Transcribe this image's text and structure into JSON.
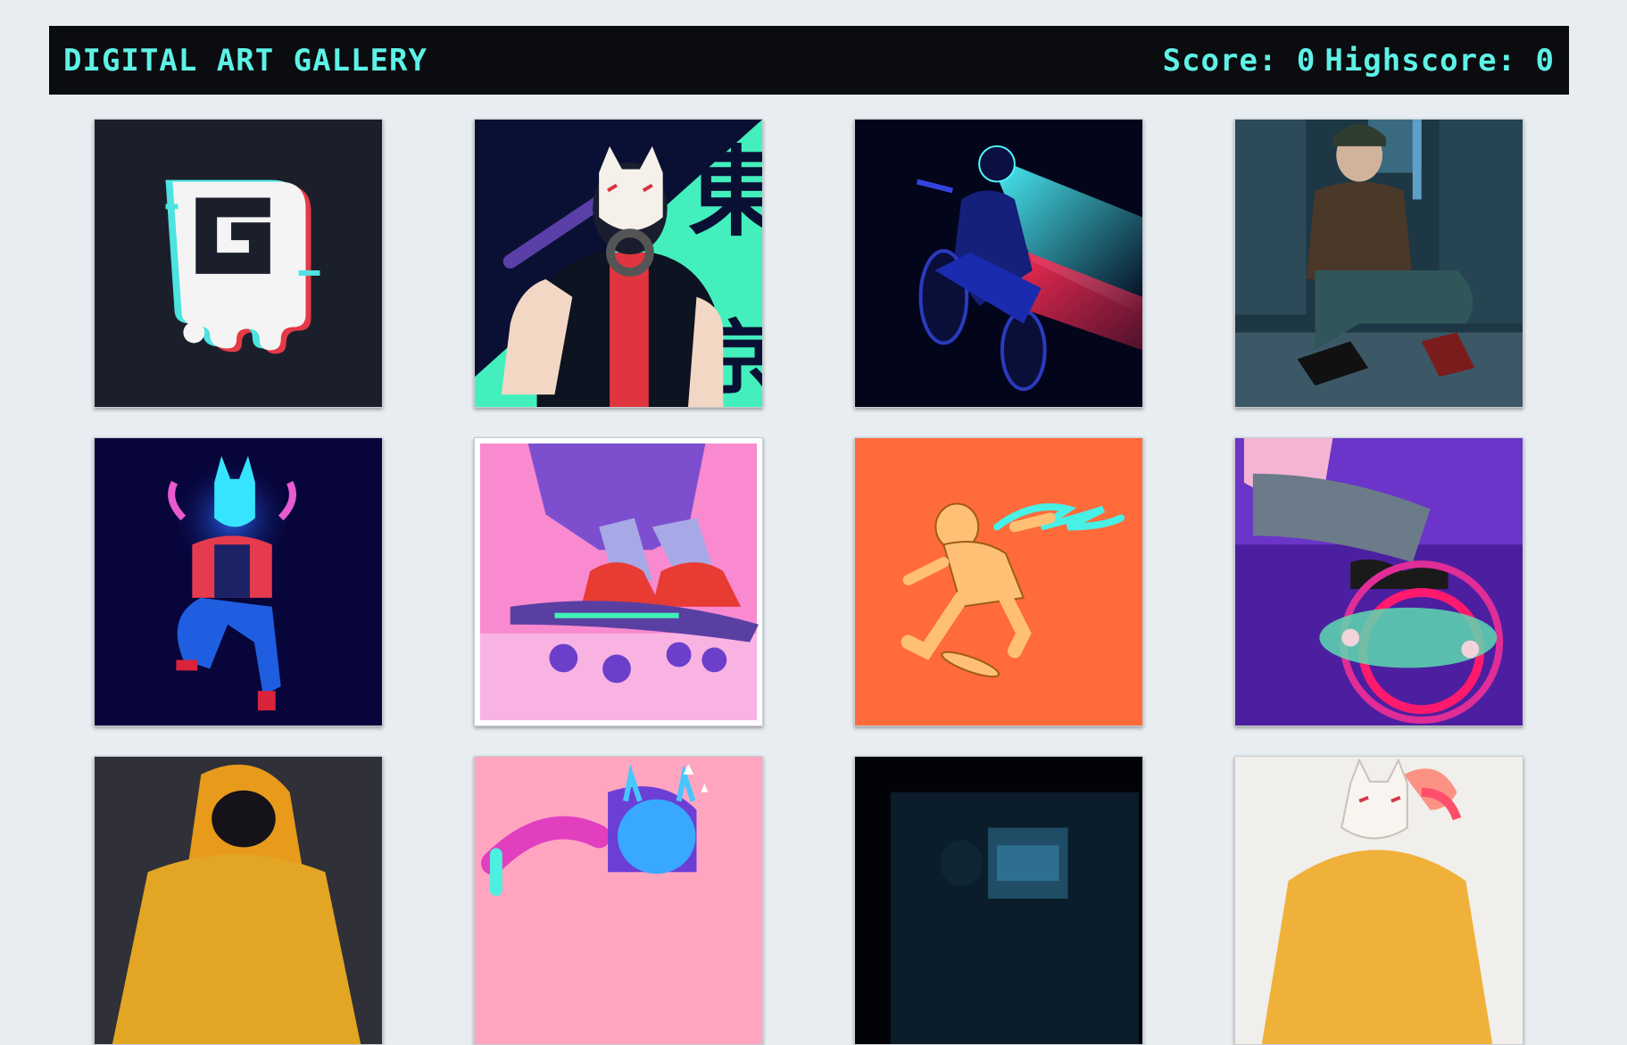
{
  "header": {
    "title": "DIGITAL ART GALLERY",
    "score_text": "Score: 0",
    "highscore_text": "Highscore: 0"
  },
  "colors": {
    "accent": "#5ef2e6",
    "header_bg": "#0a0c10",
    "page_bg": "#e8edf1"
  },
  "gallery": [
    {
      "name": "ghost-logo"
    },
    {
      "name": "fox-mask-baseball-bat"
    },
    {
      "name": "neon-motorcycle-rider"
    },
    {
      "name": "skater-sitting-street"
    },
    {
      "name": "neon-fox-figure"
    },
    {
      "name": "skateboard-sneakers-pink"
    },
    {
      "name": "orange-skater-sketch"
    },
    {
      "name": "purple-skate-trick"
    },
    {
      "name": "yellow-hoodie"
    },
    {
      "name": "oni-mask-pink"
    },
    {
      "name": "dark-blue-room"
    },
    {
      "name": "fox-mask-yellow-hoodie"
    }
  ]
}
